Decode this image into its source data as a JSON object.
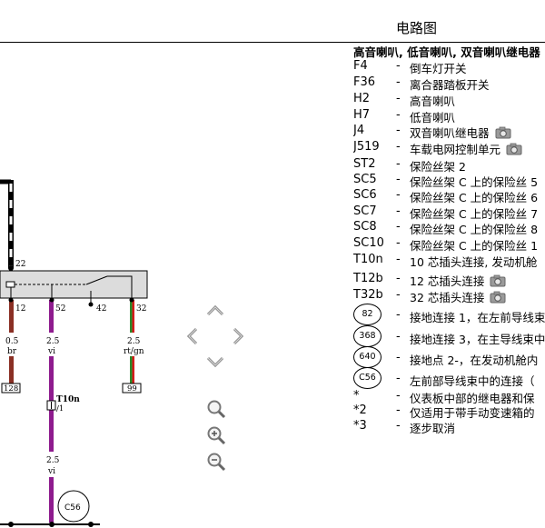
{
  "page": {
    "title": "电路图"
  },
  "legend": {
    "heading": "高音喇叭, 低音喇叭, 双音喇叭继电器",
    "items": [
      {
        "code": "F4",
        "dash": "-",
        "desc": "倒车灯开关",
        "camera": false
      },
      {
        "code": "F36",
        "dash": "-",
        "desc": "离合器踏板开关",
        "camera": false
      },
      {
        "code": "H2",
        "dash": "-",
        "desc": "高音喇叭",
        "camera": false
      },
      {
        "code": "H7",
        "dash": "-",
        "desc": "低音喇叭",
        "camera": false
      },
      {
        "code": "J4",
        "dash": "-",
        "desc": "双音喇叭继电器",
        "camera": true
      },
      {
        "code": "J519",
        "dash": "-",
        "desc": "车载电网控制单元",
        "camera": true
      },
      {
        "code": "ST2",
        "dash": "-",
        "desc": "保险丝架 2",
        "camera": false
      },
      {
        "code": "SC5",
        "dash": "-",
        "desc": "保险丝架 C 上的保险丝 5",
        "camera": false
      },
      {
        "code": "SC6",
        "dash": "-",
        "desc": "保险丝架 C 上的保险丝 6",
        "camera": false
      },
      {
        "code": "SC7",
        "dash": "-",
        "desc": "保险丝架 C 上的保险丝 7",
        "camera": false
      },
      {
        "code": "SC8",
        "dash": "-",
        "desc": "保险丝架 C 上的保险丝 8",
        "camera": false
      },
      {
        "code": "SC10",
        "dash": "-",
        "desc": "保险丝架 C 上的保险丝 1",
        "camera": false
      },
      {
        "code": "T10n",
        "dash": "-",
        "desc": "10 芯插头连接, 发动机舱",
        "camera": false
      },
      {
        "code": "T12b",
        "dash": "-",
        "desc": "12 芯插头连接",
        "camera": true
      },
      {
        "code": "T32b",
        "dash": "-",
        "desc": "32 芯插头连接",
        "camera": true
      },
      {
        "code": "82",
        "dash": "-",
        "desc": "接地连接 1，在左前导线束",
        "camera": false
      },
      {
        "code": "368",
        "dash": "-",
        "desc": "接地连接 3，在主导线束中",
        "camera": false
      },
      {
        "code": "640",
        "dash": "-",
        "desc": "接地点 2-，在发动机舱内",
        "camera": false
      },
      {
        "code": "C56",
        "dash": "-",
        "desc": "左前部导线束中的连接（",
        "camera": false
      },
      {
        "code": "*",
        "dash": "-",
        "desc": "仪表板中部的继电器和保",
        "camera": false
      },
      {
        "code": "*2",
        "dash": "-",
        "desc": "仅适用于带手动变速箱的",
        "camera": false
      },
      {
        "code": "*3",
        "dash": "-",
        "desc": "逐步取消",
        "camera": false
      }
    ]
  },
  "diagram": {
    "pin_22": "22",
    "pin_12": "12",
    "pin_52": "52",
    "pin_42": "42",
    "pin_32": "32",
    "wire_left_size": "0.5",
    "wire_left_color": "br",
    "wire_mid_size": "2.5",
    "wire_mid_color": "vi",
    "wire_right_size": "2.5",
    "wire_right_color": "rt/gn",
    "ref_128": "128",
    "ref_99": "99",
    "connector_t10n": "T10n",
    "connector_t10n_pin": "/1",
    "wire_lower_size": "2.5",
    "wire_lower_color": "vi",
    "splice_c56": "C56",
    "colors": {
      "brown": "#8a2f24",
      "violet": "#8e1b8e",
      "red": "#d41a1a",
      "green": "#2a8a2a",
      "component_fill": "#dcdcdc"
    }
  },
  "navigation": {
    "icons": [
      "arrow-up-icon",
      "arrow-left-icon",
      "arrow-right-icon",
      "arrow-down-icon",
      "zoom-reset-icon",
      "zoom-in-icon",
      "zoom-out-icon"
    ]
  }
}
